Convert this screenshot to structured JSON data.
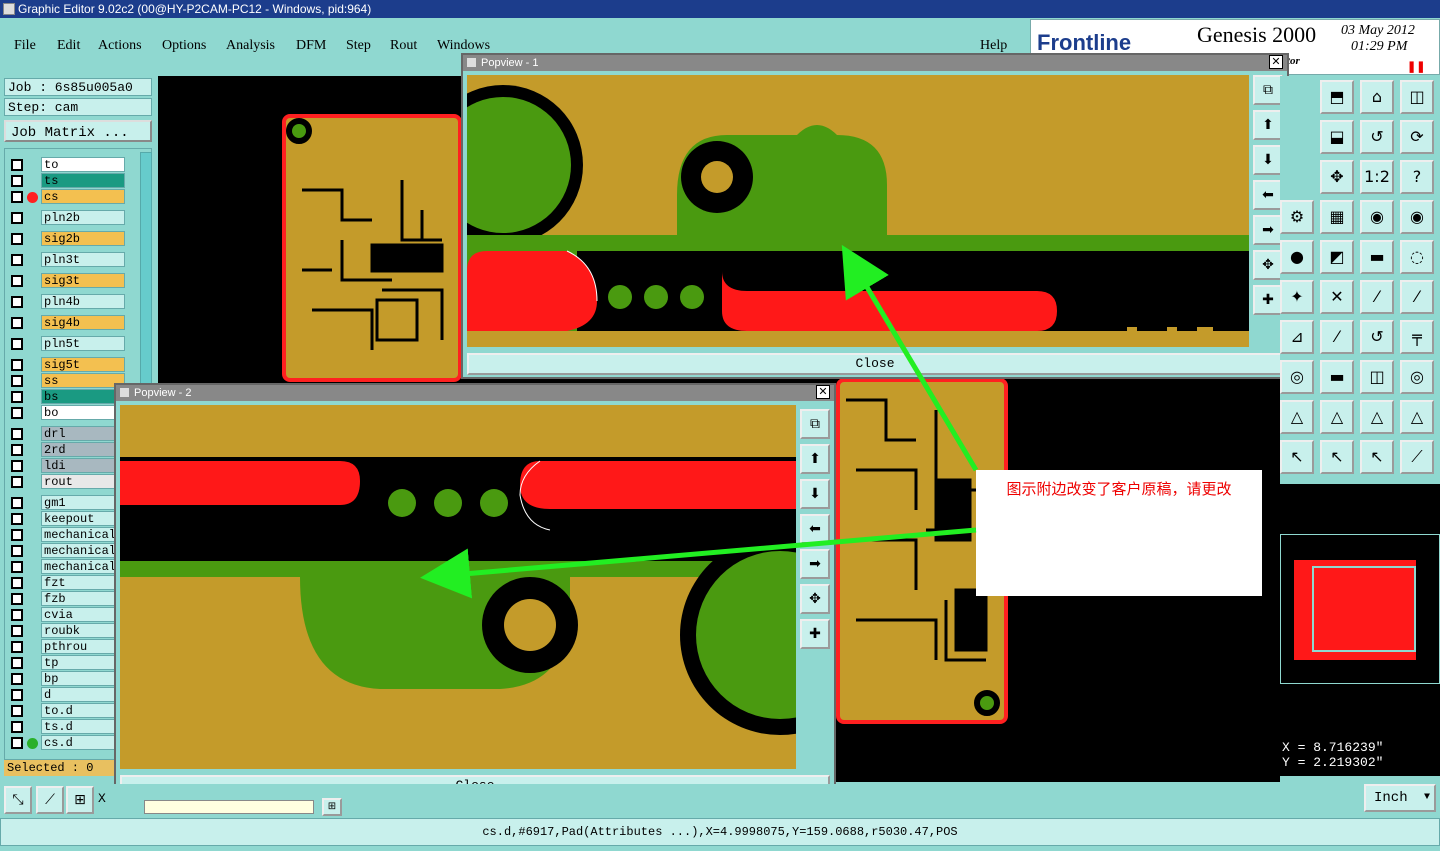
{
  "window": {
    "title": "Graphic Editor 9.02c2 (00@HY-P2CAM-PC12 - Windows, pid:964)"
  },
  "menu": {
    "items": [
      "File",
      "Edit",
      "Actions",
      "Options",
      "Analysis",
      "DFM",
      "Step",
      "Rout",
      "Windows"
    ],
    "help": "Help"
  },
  "brand": {
    "logo": "Frontline",
    "product": "Genesis 2000",
    "date": "03 May 2012",
    "time": "01:29 PM",
    "tag": "tor"
  },
  "job": {
    "job": "Job : 6s85u005a0",
    "step": "Step: cam",
    "matrix": "Job Matrix ..."
  },
  "layers": [
    {
      "name": "to",
      "color": "#ffffff"
    },
    {
      "name": "ts",
      "color": "#1a9a82"
    },
    {
      "name": "cs",
      "color": "#f3c050",
      "marker": "#ff2020"
    },
    {
      "name": "pln2b",
      "color": "#c8f0ec"
    },
    {
      "name": "sig2b",
      "color": "#f3c050"
    },
    {
      "name": "pln3t",
      "color": "#c8f0ec"
    },
    {
      "name": "sig3t",
      "color": "#f3c050"
    },
    {
      "name": "pln4b",
      "color": "#c8f0ec"
    },
    {
      "name": "sig4b",
      "color": "#f3c050"
    },
    {
      "name": "pln5t",
      "color": "#c8f0ec"
    },
    {
      "name": "sig5t",
      "color": "#f3c050"
    },
    {
      "name": "ss",
      "color": "#f3c050"
    },
    {
      "name": "bs",
      "color": "#1a9a82"
    },
    {
      "name": "bo",
      "color": "#ffffff"
    },
    {
      "name": "drl",
      "color": "#a8b8c0"
    },
    {
      "name": "2rd",
      "color": "#a8b8c0"
    },
    {
      "name": "ldi",
      "color": "#a8b8c0"
    },
    {
      "name": "rout",
      "color": "#e8e8e8"
    },
    {
      "name": "gm1",
      "color": "#c8f0ec"
    },
    {
      "name": "keepout",
      "color": "#c8f0ec"
    },
    {
      "name": "mechanical",
      "color": "#c8f0ec"
    },
    {
      "name": "mechanical",
      "color": "#c8f0ec"
    },
    {
      "name": "mechanical",
      "color": "#c8f0ec"
    },
    {
      "name": "fzt",
      "color": "#c8f0ec"
    },
    {
      "name": "fzb",
      "color": "#c8f0ec"
    },
    {
      "name": "cvia",
      "color": "#c8f0ec"
    },
    {
      "name": "roubk",
      "color": "#c8f0ec"
    },
    {
      "name": "pthrou",
      "color": "#c8f0ec"
    },
    {
      "name": "tp",
      "color": "#c8f0ec"
    },
    {
      "name": "bp",
      "color": "#c8f0ec"
    },
    {
      "name": "d",
      "color": "#c8f0ec"
    },
    {
      "name": "to.d",
      "color": "#c8f0ec"
    },
    {
      "name": "ts.d",
      "color": "#c8f0ec"
    },
    {
      "name": "cs.d",
      "color": "#c8f0ec",
      "marker": "#2ab02a"
    }
  ],
  "selected": "Selected : 0",
  "popview1": {
    "title": "Popview - 1",
    "close": "Close"
  },
  "popview2": {
    "title": "Popview - 2",
    "close": "Close"
  },
  "annotation": {
    "text": "图示附边改变了客户原稿，请更改"
  },
  "coords": {
    "x": "X =  8.716239\"",
    "y": "Y =  2.219302\""
  },
  "units": "Inch",
  "status": "cs.d,#6917,Pad(Attributes ...),X=4.9998075,Y=159.0688,r5030.47,POS",
  "colors": {
    "copper": "#c49b2a",
    "green": "#4a9a10",
    "red": "#ff1818",
    "accent_arrow": "#22ee22"
  }
}
